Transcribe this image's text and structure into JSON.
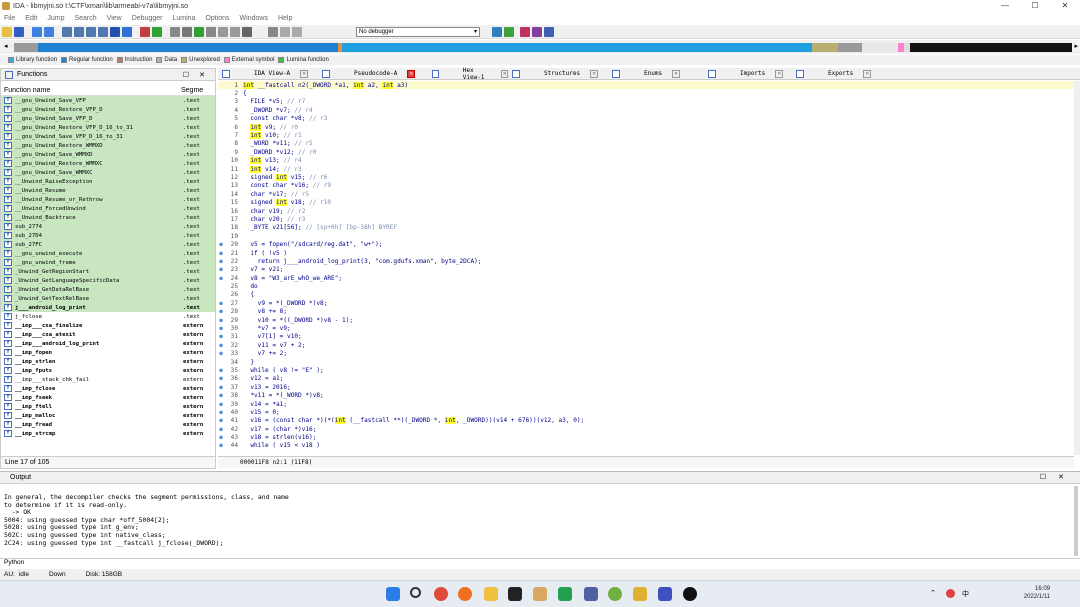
{
  "window": {
    "title": "IDA - libmyjni.so  I:\\CTF\\xmari\\lib\\armeabi-v7a\\libmyjni.so"
  },
  "menu": [
    "File",
    "Edit",
    "Jump",
    "Search",
    "View",
    "Debugger",
    "Lumina",
    "Options",
    "Windows",
    "Help"
  ],
  "toolbar": {
    "debugger_select": "No debugger"
  },
  "legend": [
    {
      "label": "Library function",
      "color": "#3da8e0"
    },
    {
      "label": "Regular function",
      "color": "#1f7fd0"
    },
    {
      "label": "Instruction",
      "color": "#b08060"
    },
    {
      "label": "Data",
      "color": "#b0b0b0"
    },
    {
      "label": "Unexplored",
      "color": "#b8b070"
    },
    {
      "label": "External symbol",
      "color": "#ff7fd0"
    },
    {
      "label": "Lumina function",
      "color": "#40c040"
    }
  ],
  "functions_panel": {
    "title": "Functions",
    "col_name": "Function name",
    "col_segment": "Segme",
    "rows": [
      {
        "name": "__gnu_Unwind_Save_VFP",
        "seg": ".text",
        "lib": true,
        "bold": false
      },
      {
        "name": "__gnu_Unwind_Restore_VFP_D",
        "seg": ".text",
        "lib": true,
        "bold": false
      },
      {
        "name": "__gnu_Unwind_Save_VFP_D",
        "seg": ".text",
        "lib": true,
        "bold": false
      },
      {
        "name": "__gnu_Unwind_Restore_VFP_D_16_to_31",
        "seg": ".text",
        "lib": true,
        "bold": false
      },
      {
        "name": "__gnu_Unwind_Save_VFP_D_16_to_31",
        "seg": ".text",
        "lib": true,
        "bold": false
      },
      {
        "name": "__gnu_Unwind_Restore_WMMXD",
        "seg": ".text",
        "lib": true,
        "bold": false
      },
      {
        "name": "__gnu_Unwind_Save_WMMXD",
        "seg": ".text",
        "lib": true,
        "bold": false
      },
      {
        "name": "__gnu_Unwind_Restore_WMMXC",
        "seg": ".text",
        "lib": true,
        "bold": false
      },
      {
        "name": "__gnu_Unwind_Save_WMMXC",
        "seg": ".text",
        "lib": true,
        "bold": false
      },
      {
        "name": "__Unwind_RaiseException",
        "seg": ".text",
        "lib": true,
        "bold": false
      },
      {
        "name": "__Unwind_Resume",
        "seg": ".text",
        "lib": true,
        "bold": false
      },
      {
        "name": "__Unwind_Resume_or_Rethrow",
        "seg": ".text",
        "lib": true,
        "bold": false
      },
      {
        "name": "__Unwind_ForcedUnwind",
        "seg": ".text",
        "lib": true,
        "bold": false
      },
      {
        "name": "__Unwind_Backtrace",
        "seg": ".text",
        "lib": true,
        "bold": false
      },
      {
        "name": "sub_2774",
        "seg": ".text",
        "lib": true,
        "bold": false
      },
      {
        "name": "sub_27D4",
        "seg": ".text",
        "lib": true,
        "bold": false
      },
      {
        "name": "sub_27FC",
        "seg": ".text",
        "lib": true,
        "bold": false
      },
      {
        "name": "__gnu_unwind_execute",
        "seg": ".text",
        "lib": true,
        "bold": false
      },
      {
        "name": "__gnu_unwind_frame",
        "seg": ".text",
        "lib": true,
        "bold": false
      },
      {
        "name": "_Unwind_GetRegionStart",
        "seg": ".text",
        "lib": true,
        "bold": false
      },
      {
        "name": "_Unwind_GetLanguageSpecificData",
        "seg": ".text",
        "lib": true,
        "bold": false
      },
      {
        "name": "_Unwind_GetDataRelBase",
        "seg": ".text",
        "lib": true,
        "bold": false
      },
      {
        "name": "_Unwind_GetTextRelBase",
        "seg": ".text",
        "lib": true,
        "bold": false
      },
      {
        "name": "j___android_log_print",
        "seg": ".text",
        "lib": true,
        "bold": true
      },
      {
        "name": "j_fclose",
        "seg": ".text",
        "lib": false,
        "bold": false
      },
      {
        "name": "__imp___cxa_finalize",
        "seg": "extern",
        "lib": false,
        "bold": true
      },
      {
        "name": "__imp___cxa_atexit",
        "seg": "extern",
        "lib": false,
        "bold": true
      },
      {
        "name": "__imp___android_log_print",
        "seg": "extern",
        "lib": false,
        "bold": true
      },
      {
        "name": "__imp_fopen",
        "seg": "extern",
        "lib": false,
        "bold": true
      },
      {
        "name": "__imp_strlen",
        "seg": "extern",
        "lib": false,
        "bold": true
      },
      {
        "name": "__imp_fputs",
        "seg": "extern",
        "lib": false,
        "bold": true
      },
      {
        "name": "__imp___stack_chk_fail",
        "seg": "extern",
        "lib": false,
        "bold": false
      },
      {
        "name": "__imp_fclose",
        "seg": "extern",
        "lib": false,
        "bold": true
      },
      {
        "name": "__imp_fseek",
        "seg": "extern",
        "lib": false,
        "bold": true
      },
      {
        "name": "__imp_ftell",
        "seg": "extern",
        "lib": false,
        "bold": true
      },
      {
        "name": "__imp_malloc",
        "seg": "extern",
        "lib": false,
        "bold": true
      },
      {
        "name": "__imp_fread",
        "seg": "extern",
        "lib": false,
        "bold": true
      },
      {
        "name": "__imp_strcmp",
        "seg": "extern",
        "lib": false,
        "bold": true
      }
    ],
    "status": "Line 17 of 105"
  },
  "tabs": [
    {
      "label": "IDA View-A",
      "active": false
    },
    {
      "label": "Pseudocode-A",
      "active": true
    },
    {
      "label": "Hex View-1",
      "active": false
    },
    {
      "label": "Structures",
      "active": false
    },
    {
      "label": "Enums",
      "active": false
    },
    {
      "label": "Imports",
      "active": false
    },
    {
      "label": "Exports",
      "active": false
    }
  ],
  "code": [
    {
      "n": "1",
      "t": "int __fastcall n2(_DWORD *a1, int a2, int a3)",
      "d": false
    },
    {
      "n": "2",
      "t": "{",
      "d": false
    },
    {
      "n": "3",
      "t": "  FILE *v5; // r7",
      "d": false
    },
    {
      "n": "4",
      "t": "  _DWORD *v7; // r4",
      "d": false
    },
    {
      "n": "5",
      "t": "  const char *v8; // r3",
      "d": false
    },
    {
      "n": "6",
      "t": "  int v9; // r0",
      "d": false
    },
    {
      "n": "7",
      "t": "  int v10; // r1",
      "d": false
    },
    {
      "n": "8",
      "t": "  _WORD *v11; // r5",
      "d": false
    },
    {
      "n": "9",
      "t": "  _DWORD *v12; // r0",
      "d": false
    },
    {
      "n": "10",
      "t": "  int v13; // r4",
      "d": false
    },
    {
      "n": "11",
      "t": "  int v14; // r3",
      "d": false
    },
    {
      "n": "12",
      "t": "  signed int v15; // r6",
      "d": false
    },
    {
      "n": "13",
      "t": "  const char *v16; // r9",
      "d": false
    },
    {
      "n": "14",
      "t": "  char *v17; // r5",
      "d": false
    },
    {
      "n": "15",
      "t": "  signed int v18; // r10",
      "d": false
    },
    {
      "n": "16",
      "t": "  char v19; // r2",
      "d": false
    },
    {
      "n": "17",
      "t": "  char v20; // r3",
      "d": false
    },
    {
      "n": "18",
      "t": "  _BYTE v21[56]; // [sp+0h] [bp-38h] BYREF",
      "d": false
    },
    {
      "n": "19",
      "t": "",
      "d": false
    },
    {
      "n": "20",
      "t": "  v5 = fopen(\"/sdcard/reg.dat\", \"w+\");",
      "d": true
    },
    {
      "n": "21",
      "t": "  if ( !v5 )",
      "d": true
    },
    {
      "n": "22",
      "t": "    return j___android_log_print(3, \"com.gdufs.xman\", byte_2DCA);",
      "d": true
    },
    {
      "n": "23",
      "t": "  v7 = v21;",
      "d": true
    },
    {
      "n": "24",
      "t": "  v8 = \"W3_arE_whO_we_ARE\";",
      "d": true
    },
    {
      "n": "25",
      "t": "  do",
      "d": false
    },
    {
      "n": "26",
      "t": "  {",
      "d": false
    },
    {
      "n": "27",
      "t": "    v9 = *(_DWORD *)v8;",
      "d": true
    },
    {
      "n": "28",
      "t": "    v8 += 8;",
      "d": true
    },
    {
      "n": "29",
      "t": "    v10 = *((_DWORD *)v8 - 1);",
      "d": true
    },
    {
      "n": "30",
      "t": "    *v7 = v9;",
      "d": true
    },
    {
      "n": "31",
      "t": "    v7[1] = v10;",
      "d": true
    },
    {
      "n": "32",
      "t": "    v11 = v7 + 2;",
      "d": true
    },
    {
      "n": "33",
      "t": "    v7 += 2;",
      "d": true
    },
    {
      "n": "34",
      "t": "  }",
      "d": false
    },
    {
      "n": "35",
      "t": "  while ( v8 != \"E\" );",
      "d": true
    },
    {
      "n": "36",
      "t": "  v12 = a1;",
      "d": true
    },
    {
      "n": "37",
      "t": "  v13 = 2016;",
      "d": true
    },
    {
      "n": "38",
      "t": "  *v11 = *(_WORD *)v8;",
      "d": true
    },
    {
      "n": "39",
      "t": "  v14 = *a1;",
      "d": true
    },
    {
      "n": "40",
      "t": "  v15 = 0;",
      "d": true
    },
    {
      "n": "41",
      "t": "  v16 = (const char *)(*(int (__fastcall **)(_DWORD *, int, _DWORD))(v14 + 676))(v12, a3, 0);",
      "d": true
    },
    {
      "n": "42",
      "t": "  v17 = (char *)v16;",
      "d": true
    },
    {
      "n": "43",
      "t": "  v18 = strlen(v16);",
      "d": true
    },
    {
      "n": "44",
      "t": "  while ( v15 < v18 )",
      "d": true
    }
  ],
  "code_status": "000011F8 n2:1 (11F8)",
  "output": {
    "title": "Output",
    "lines": [
      "In general, the decompiler checks the segment permissions, class, and name",
      "to determine if it is read-only.",
      "  -> OK",
      "5004: using guessed type char *off_5004[2];",
      "5028: using guessed type int g_env;",
      "502C: using guessed type int native_class;",
      "2C24: using guessed type int __fastcall j_fclose(_DWORD);"
    ]
  },
  "python_label": "Python",
  "status": {
    "mode": "AU:",
    "state": "idle",
    "dir": "Down",
    "disk": "Disk: 158GB"
  },
  "clock": {
    "time": "16:09",
    "date": "2022/1/11"
  }
}
